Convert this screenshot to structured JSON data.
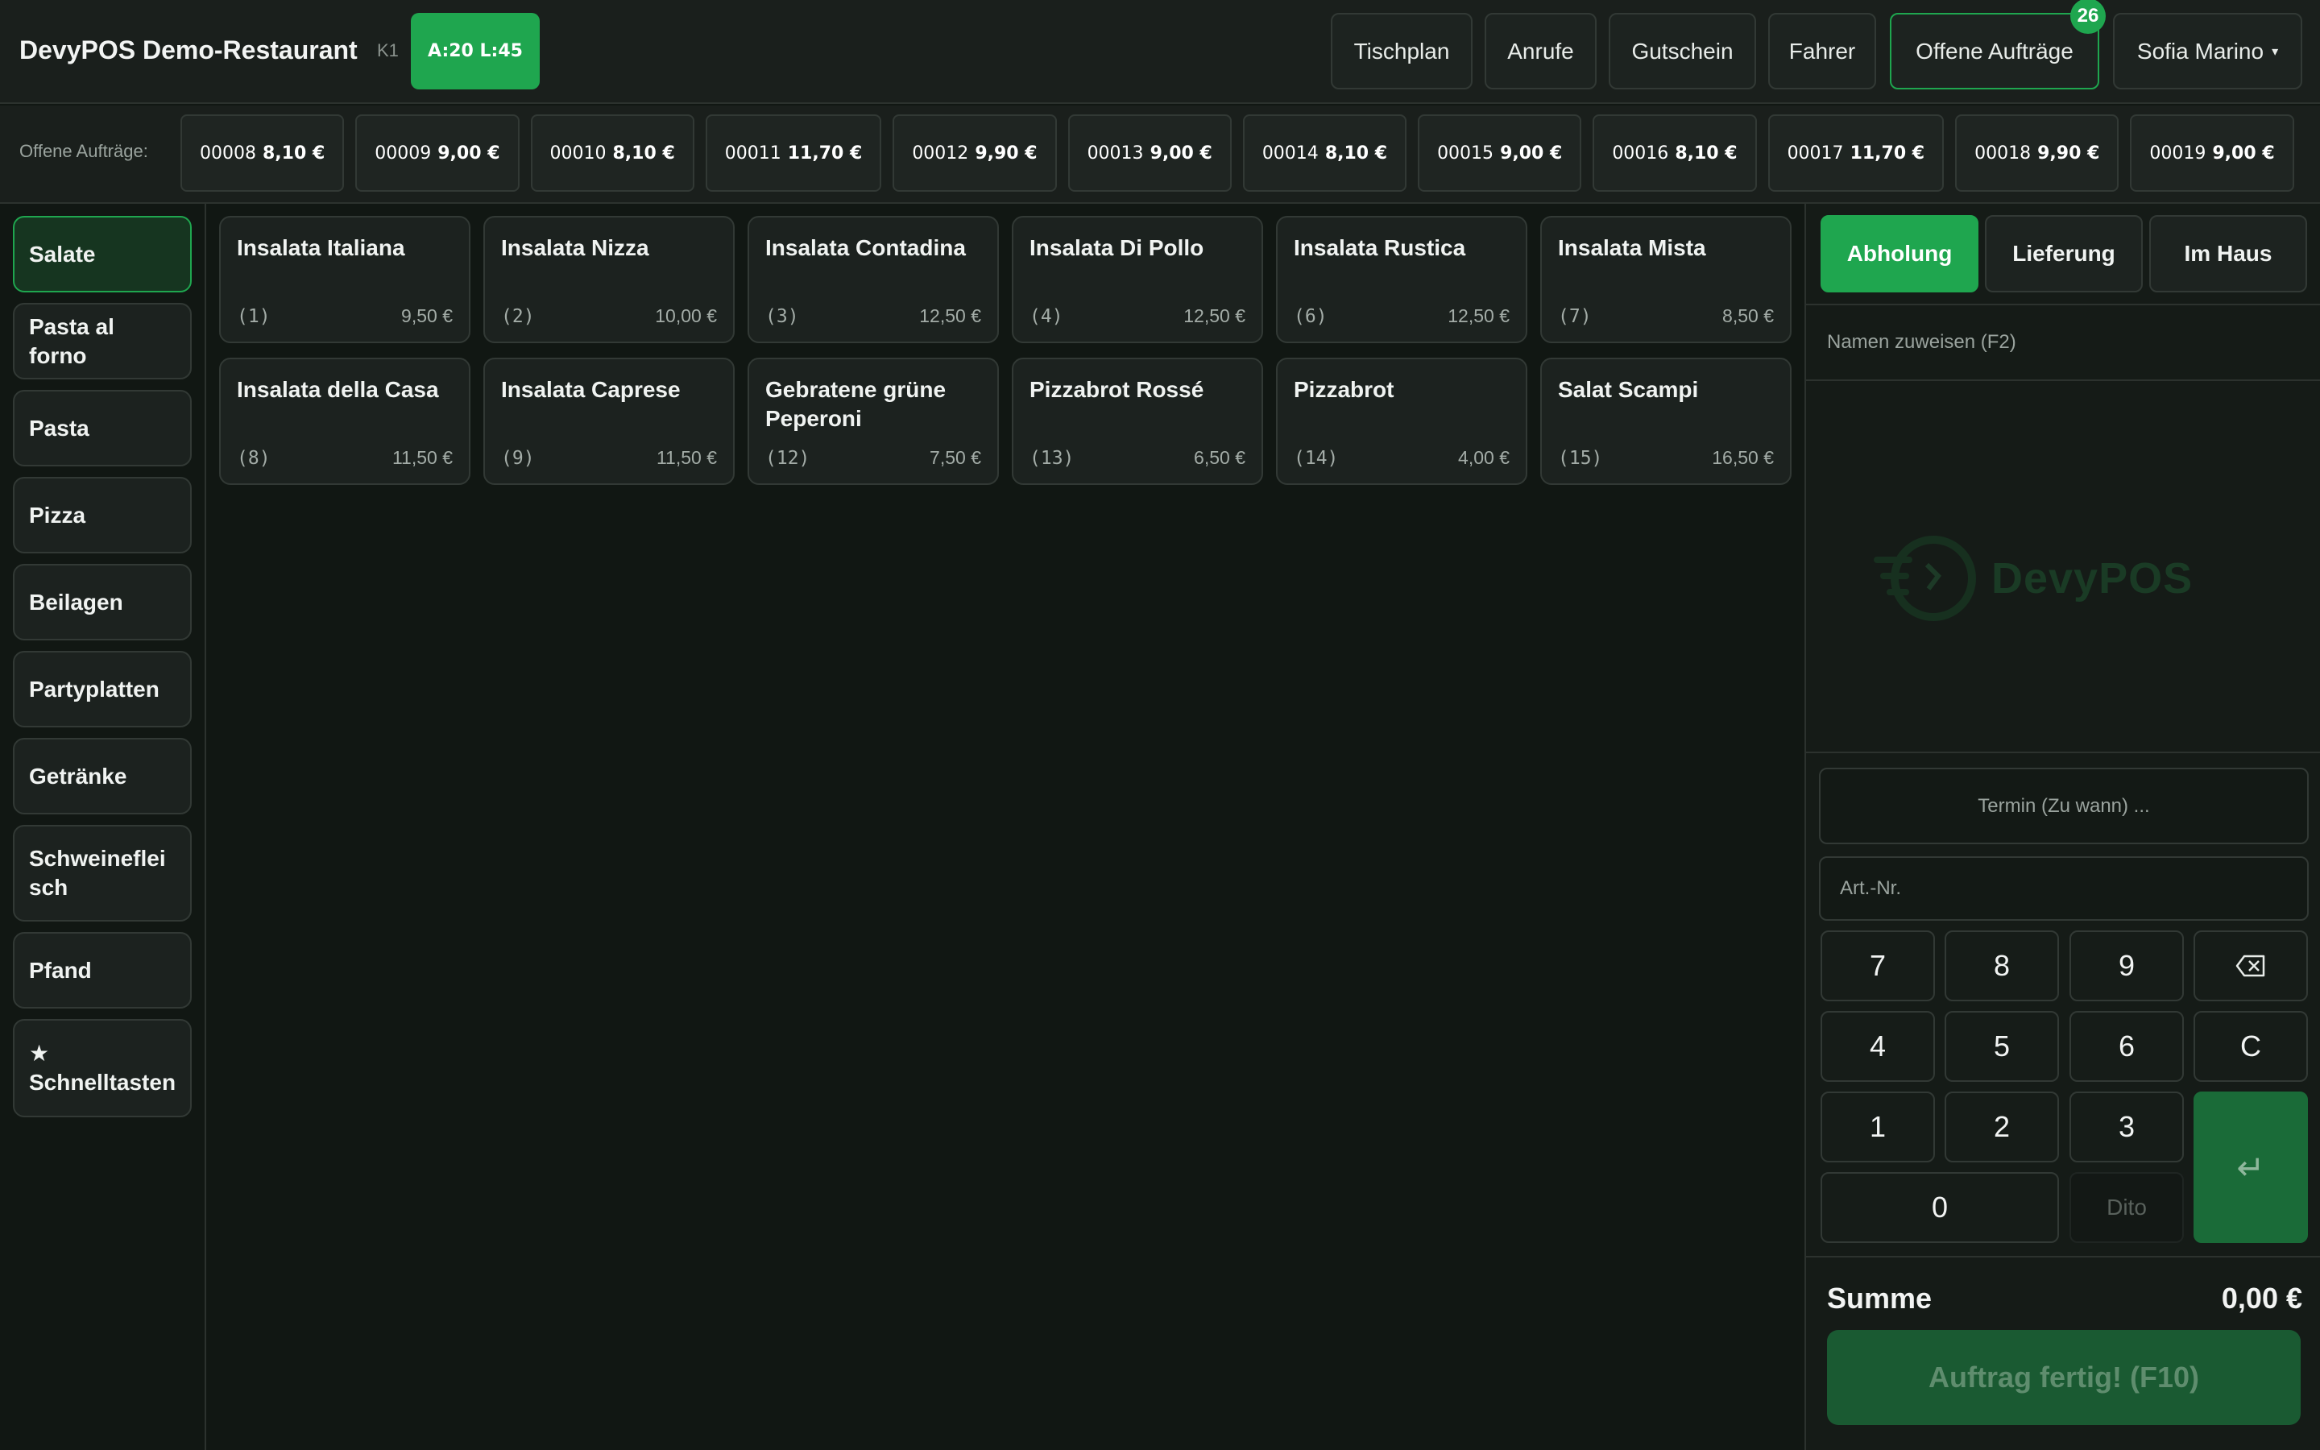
{
  "header": {
    "title": "DevyPOS Demo-Restaurant",
    "terminal": "K1",
    "counter": "A:20 L:45",
    "nav": [
      {
        "label": "Tischplan"
      },
      {
        "label": "Anrufe"
      },
      {
        "label": "Gutschein"
      },
      {
        "label": "Fahrer"
      },
      {
        "label": "Offene Aufträge",
        "badge": "26"
      }
    ],
    "user": "Sofia Marino",
    "user_caret": "▾"
  },
  "open_orders": {
    "label": "Offene Aufträge:",
    "items": [
      {
        "number": "00008",
        "amount": "8,10 €"
      },
      {
        "number": "00009",
        "amount": "9,00 €"
      },
      {
        "number": "00010",
        "amount": "8,10 €"
      },
      {
        "number": "00011",
        "amount": "11,70 €"
      },
      {
        "number": "00012",
        "amount": "9,90 €"
      },
      {
        "number": "00013",
        "amount": "9,00 €"
      },
      {
        "number": "00014",
        "amount": "8,10 €"
      },
      {
        "number": "00015",
        "amount": "9,00 €"
      },
      {
        "number": "00016",
        "amount": "8,10 €"
      },
      {
        "number": "00017",
        "amount": "11,70 €"
      },
      {
        "number": "00018",
        "amount": "9,90 €"
      },
      {
        "number": "00019",
        "amount": "9,00 €"
      }
    ]
  },
  "categories": [
    {
      "label": "Salate",
      "active": true
    },
    {
      "label": "Pasta al forno"
    },
    {
      "label": "Pasta"
    },
    {
      "label": "Pizza"
    },
    {
      "label": "Beilagen"
    },
    {
      "label": "Partyplatten"
    },
    {
      "label": "Getränke"
    },
    {
      "label": "Schweinefleisch"
    },
    {
      "label": "Pfand"
    },
    {
      "label": "Schnelltasten",
      "icon": "star-icon",
      "glyph": "★"
    }
  ],
  "products": [
    {
      "name": "Insalata Italiana",
      "number": "(1)",
      "price": "9,50 €"
    },
    {
      "name": "Insalata Nizza",
      "number": "(2)",
      "price": "10,00 €"
    },
    {
      "name": "Insalata Contadina",
      "number": "(3)",
      "price": "12,50 €"
    },
    {
      "name": "Insalata Di Pollo",
      "number": "(4)",
      "price": "12,50 €"
    },
    {
      "name": "Insalata Rustica",
      "number": "(6)",
      "price": "12,50 €"
    },
    {
      "name": "Insalata Mista",
      "number": "(7)",
      "price": "8,50 €"
    },
    {
      "name": "Insalata della Casa",
      "number": "(8)",
      "price": "11,50 €"
    },
    {
      "name": "Insalata Caprese",
      "number": "(9)",
      "price": "11,50 €"
    },
    {
      "name": "Gebratene grüne Peperoni",
      "number": "(12)",
      "price": "7,50 €"
    },
    {
      "name": "Pizzabrot Rossé",
      "number": "(13)",
      "price": "6,50 €"
    },
    {
      "name": "Pizzabrot",
      "number": "(14)",
      "price": "4,00 €"
    },
    {
      "name": "Salat Scampi",
      "number": "(15)",
      "price": "16,50 €"
    }
  ],
  "order_panel": {
    "types": [
      {
        "label": "Abholung",
        "active": true
      },
      {
        "label": "Lieferung"
      },
      {
        "label": "Im Haus"
      }
    ],
    "name_prompt": "Namen zuweisen (F2)",
    "logo_text": "DevyPOS",
    "schedule_placeholder": "Termin (Zu wann) ...",
    "article_placeholder": "Art.-Nr.",
    "keypad": {
      "k7": "7",
      "k8": "8",
      "k9": "9",
      "backspace_icon": "backspace-icon",
      "k4": "4",
      "k5": "5",
      "k6": "6",
      "clear": "C",
      "k1": "1",
      "k2": "2",
      "k3": "3",
      "enter": "↵",
      "k0": "0",
      "ditto": "Dito"
    },
    "sum_label": "Summe",
    "sum_value": "0,00 €",
    "finish_label": "Auftrag fertig! (F10)"
  },
  "colors": {
    "accent": "#1fa64f",
    "background": "#111713",
    "panel": "#1a1f1c"
  }
}
